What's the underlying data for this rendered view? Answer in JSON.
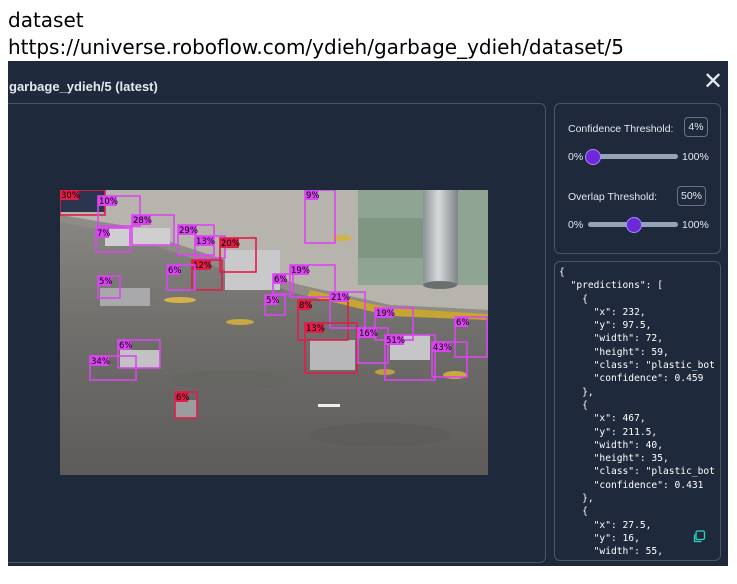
{
  "page": {
    "heading_line1": "dataset",
    "heading_line2": "https://universe.roboflow.com/ydieh/garbage_ydieh/dataset/5"
  },
  "panel": {
    "title": "garbage_ydieh/5 (latest)",
    "close_glyph": "✕"
  },
  "settings": {
    "confidence": {
      "label": "Confidence Threshold:",
      "value": "4%",
      "min_label": "0%",
      "max_label": "100%",
      "level": 0.04
    },
    "overlap": {
      "label": "Overlap Threshold:",
      "value": "50%",
      "min_label": "0%",
      "max_label": "100%",
      "level": 0.5
    }
  },
  "detections": [
    {
      "label": "30%",
      "color": "#e11d48"
    },
    {
      "label": "10%",
      "color": "#d946ef"
    },
    {
      "label": "28%",
      "color": "#d946ef"
    },
    {
      "label": "7%",
      "color": "#d946ef"
    },
    {
      "label": "29%",
      "color": "#d946ef"
    },
    {
      "label": "13%",
      "color": "#d946ef"
    },
    {
      "label": "20%",
      "color": "#e11d48"
    },
    {
      "label": "9%",
      "color": "#d946ef"
    },
    {
      "label": "12%",
      "color": "#e11d48"
    },
    {
      "label": "6%",
      "color": "#d946ef"
    },
    {
      "label": "5%",
      "color": "#d946ef"
    },
    {
      "label": "19%",
      "color": "#d946ef"
    },
    {
      "label": "6%",
      "color": "#d946ef"
    },
    {
      "label": "5%",
      "color": "#d946ef"
    },
    {
      "label": "8%",
      "color": "#e11d48"
    },
    {
      "label": "21%",
      "color": "#d946ef"
    },
    {
      "label": "19%",
      "color": "#d946ef"
    },
    {
      "label": "13%",
      "color": "#e11d48"
    },
    {
      "label": "16%",
      "color": "#d946ef"
    },
    {
      "label": "51%",
      "color": "#d946ef"
    },
    {
      "label": "43%",
      "color": "#d946ef"
    },
    {
      "label": "6%",
      "color": "#d946ef"
    },
    {
      "label": "6%",
      "color": "#d946ef"
    },
    {
      "label": "34%",
      "color": "#d946ef"
    },
    {
      "label": "6%",
      "color": "#e11d48"
    }
  ],
  "json_output": "{\n  \"predictions\": [\n    {\n      \"x\": 232,\n      \"y\": 97.5,\n      \"width\": 72,\n      \"height\": 59,\n      \"class\": \"plastic_bot\n      \"confidence\": 0.459\n    },\n    {\n      \"x\": 467,\n      \"y\": 211.5,\n      \"width\": 40,\n      \"height\": 35,\n      \"class\": \"plastic_bot\n      \"confidence\": 0.431\n    },\n    {\n      \"x\": 27.5,\n      \"y\": 16,\n      \"width\": 55,",
  "icons": {
    "close": "close-icon",
    "copy": "copy-icon"
  }
}
